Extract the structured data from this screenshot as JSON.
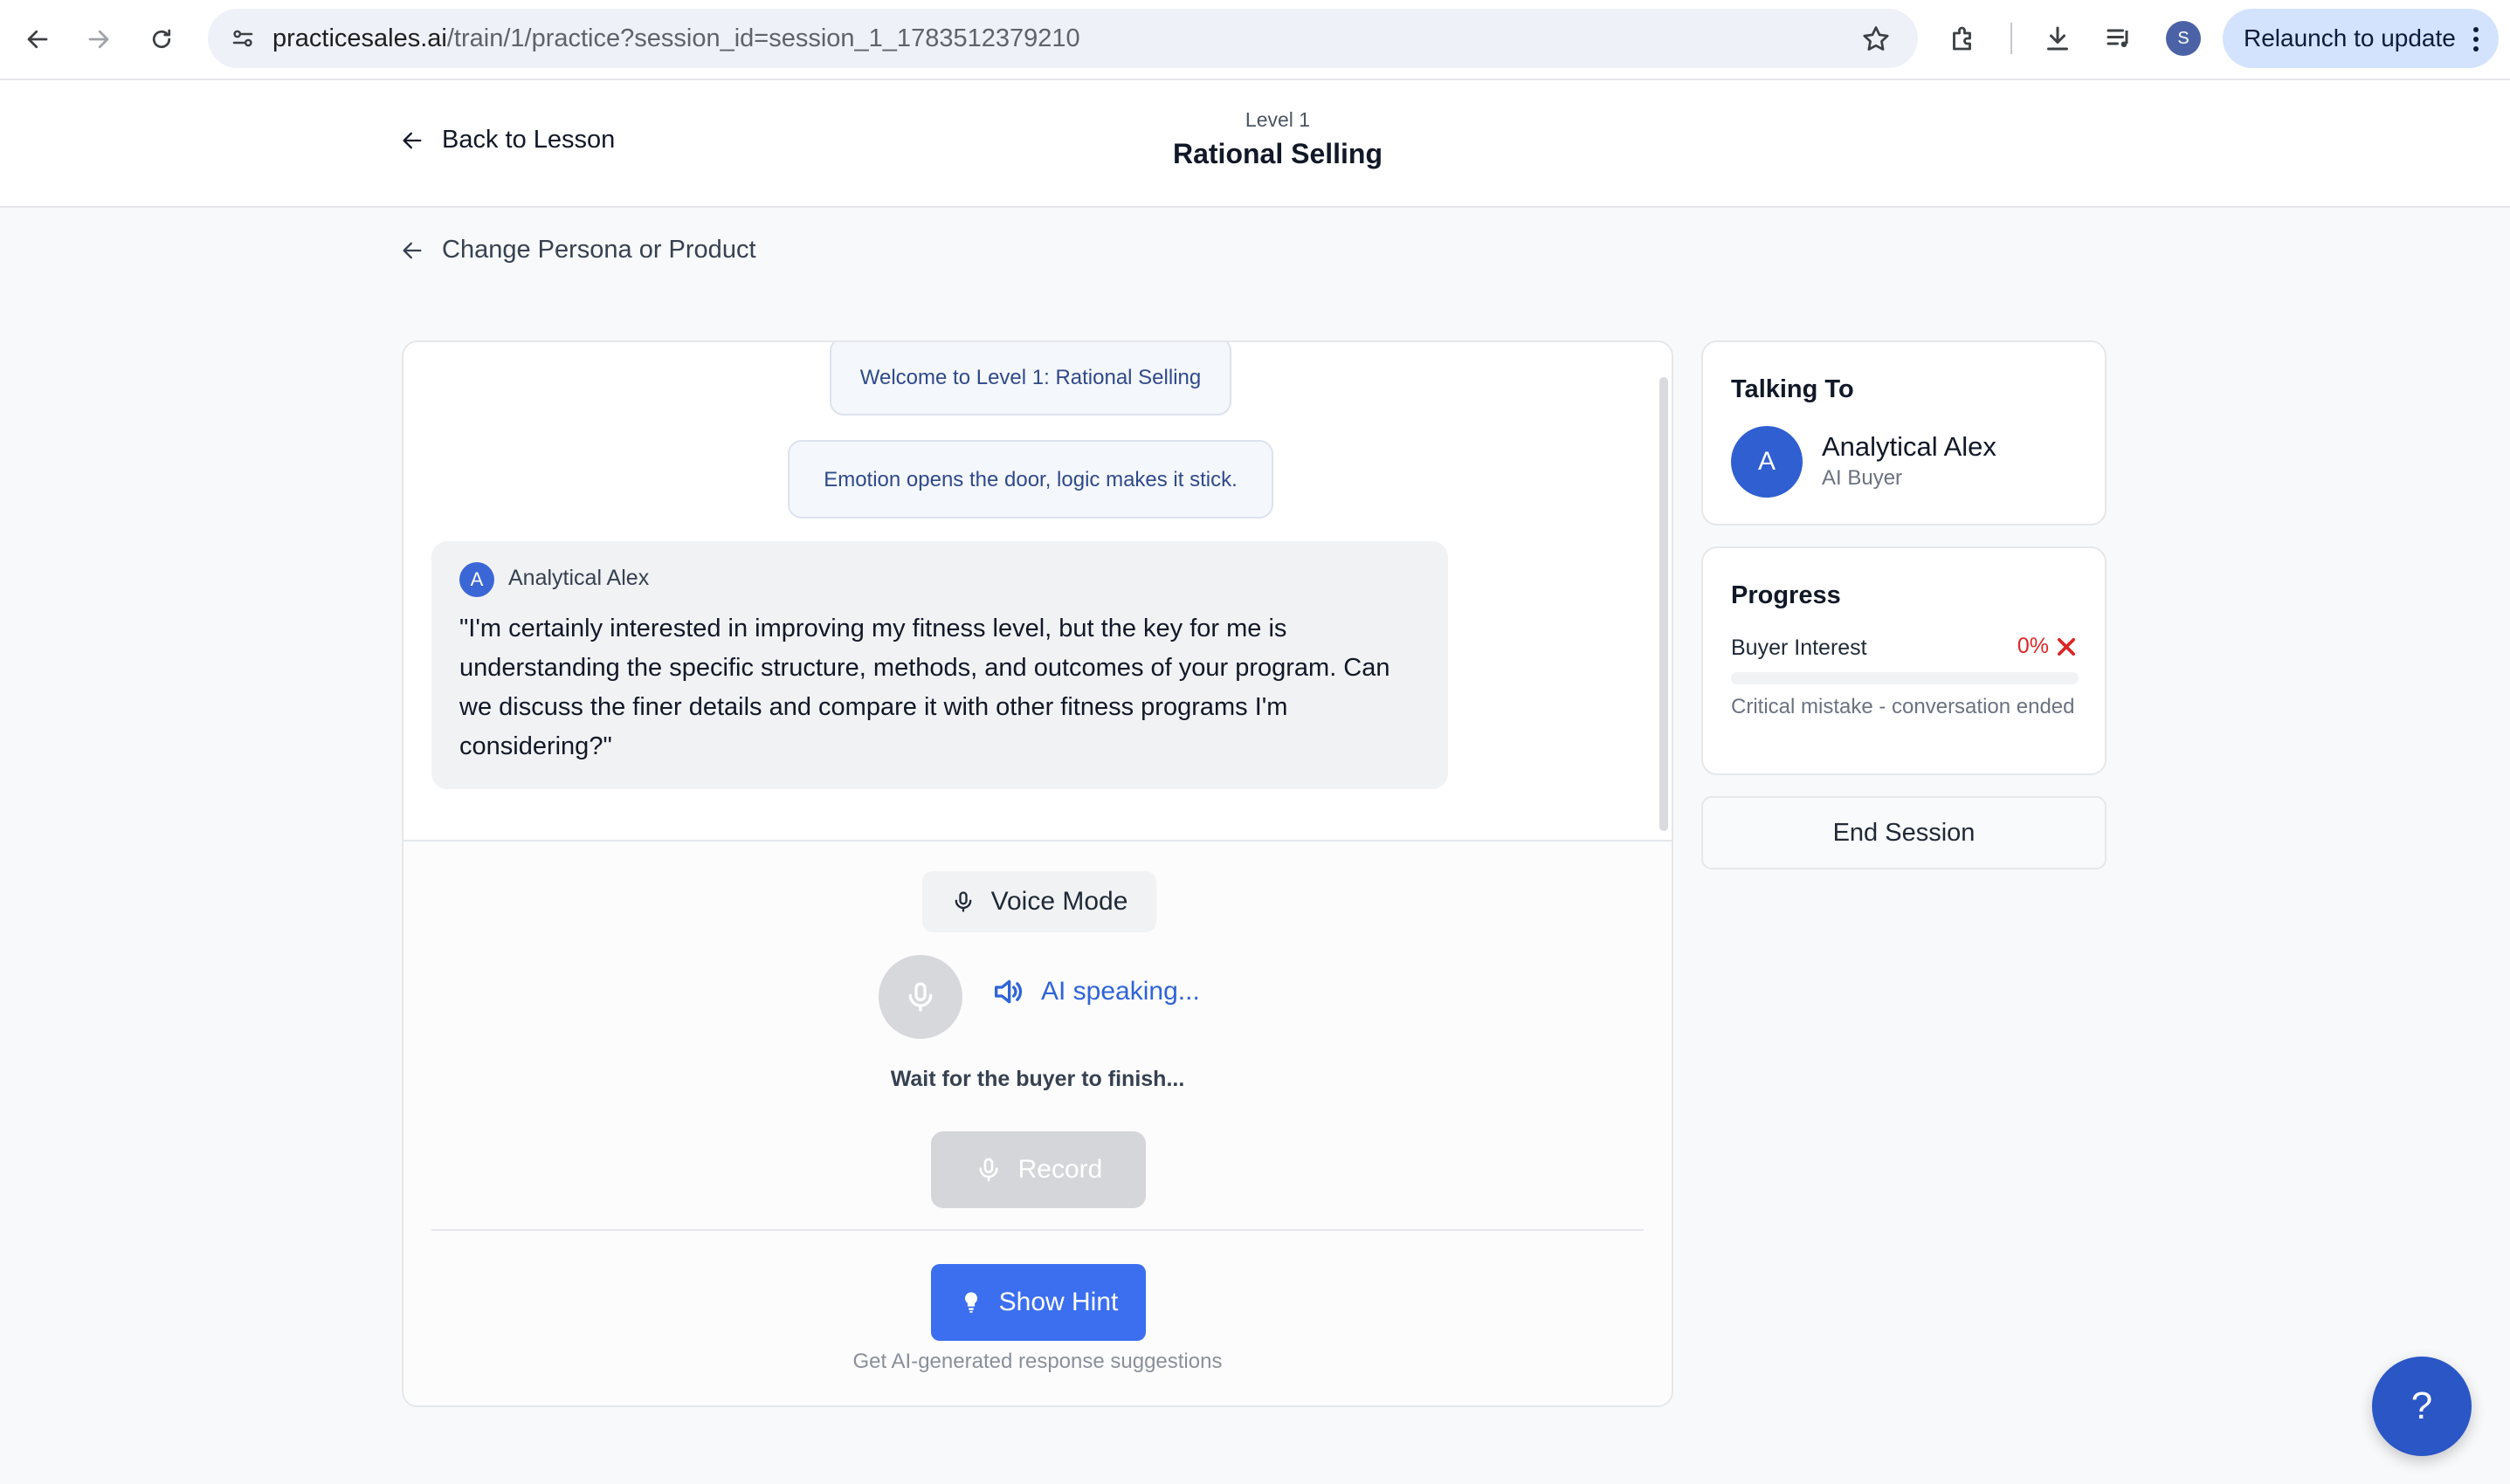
{
  "browser": {
    "url_host": "practicesales.ai",
    "url_path": "/train/1/practice?session_id=session_1_1783512379210",
    "profile_initial": "S",
    "relaunch_label": "Relaunch to update"
  },
  "header": {
    "back_label": "Back to Lesson",
    "level_label": "Level 1",
    "title": "Rational Selling"
  },
  "change_persona_label": "Change Persona or Product",
  "chat": {
    "system_messages": [
      "Welcome to Level 1: Rational Selling",
      "Emotion opens the door, logic makes it stick."
    ],
    "buyer_message": {
      "avatar_initial": "A",
      "sender": "Analytical Alex",
      "text": "\"I'm certainly interested in improving my fitness level, but the key for me is understanding the specific structure, methods, and outcomes of your program. Can we discuss the finer details and compare it with other fitness programs I'm considering?\""
    }
  },
  "controls": {
    "voice_mode_label": "Voice Mode",
    "ai_status": "AI speaking...",
    "wait_text": "Wait for the buyer to finish...",
    "record_label": "Record",
    "hint_label": "Show Hint",
    "hint_caption": "Get AI-generated response suggestions"
  },
  "talking_to": {
    "heading": "Talking To",
    "avatar_initial": "A",
    "name": "Analytical Alex",
    "role": "AI Buyer"
  },
  "progress": {
    "heading": "Progress",
    "label": "Buyer Interest",
    "value": "0%",
    "fraction": 0,
    "note": "Critical mistake - conversation ended"
  },
  "end_session_label": "End Session",
  "help_label": "?",
  "colors": {
    "accent": "#3b6ff0",
    "error": "#dc2626",
    "help_fab": "#2a56c6"
  }
}
